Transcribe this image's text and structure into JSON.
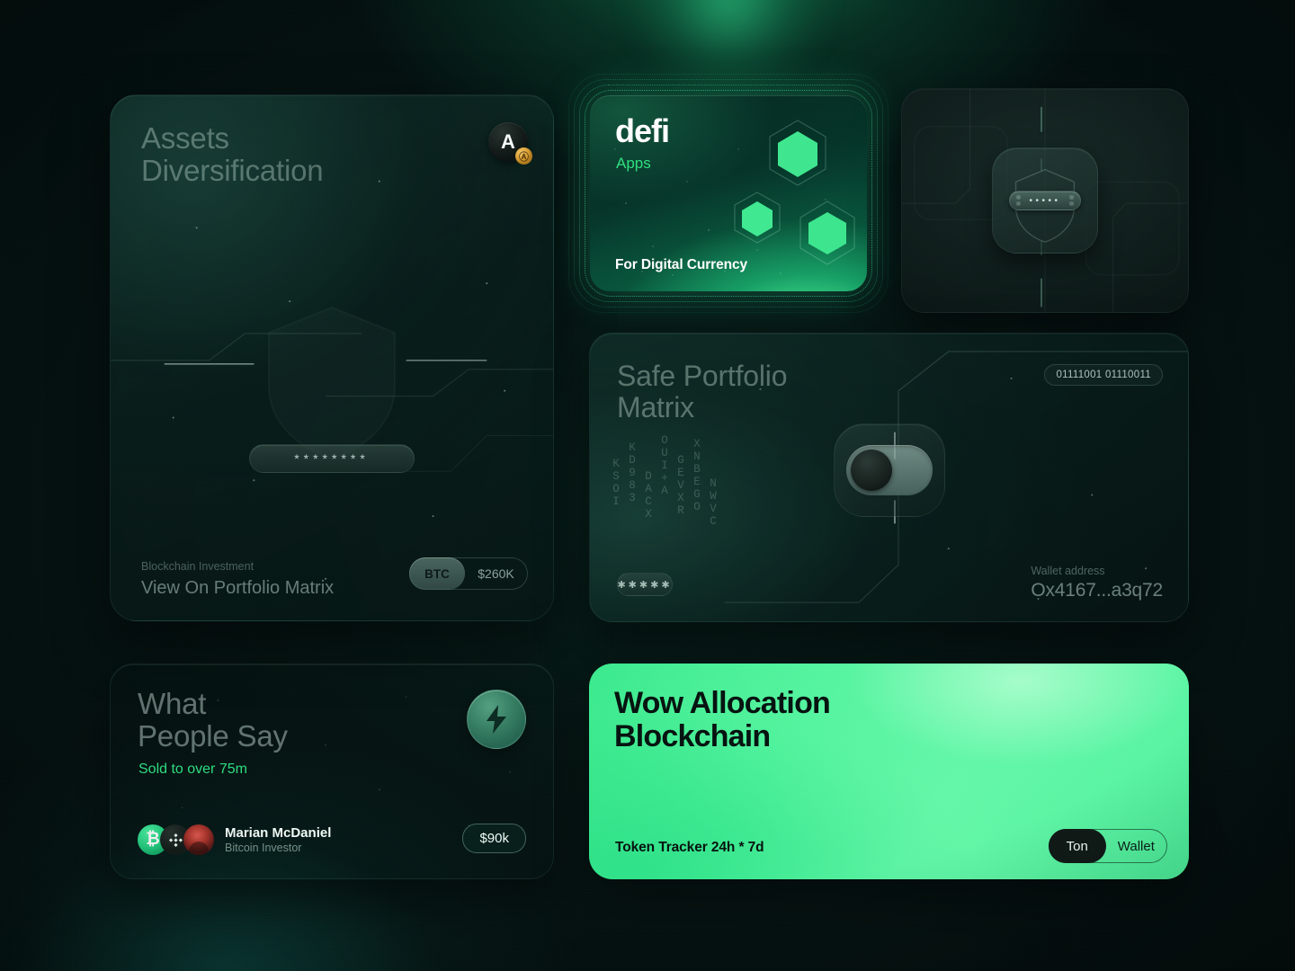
{
  "theme": {
    "accent_green": "#2fdc7f",
    "bright_green": "#4ff29b",
    "dark_bg": "#040d0d",
    "muted_text": "#c4dcd2"
  },
  "assets_card": {
    "title_line1": "Assets",
    "title_line2": "Diversification",
    "badge_glyph": "A",
    "badge_sub_glyph": "Ⓐ",
    "password_mask": "********",
    "kicker": "Blockchain Investment",
    "foot_title": "View On Portfolio Matrix",
    "pill_active": "BTC",
    "pill_value": "$260K"
  },
  "defi_card": {
    "logo": "defi",
    "subtitle": "Apps",
    "tagline": "For Digital Currency"
  },
  "secure_card": {
    "chip_dots": "•••••"
  },
  "matrix_card": {
    "title_line1": "Safe Portfolio",
    "title_line2": "Matrix",
    "binary_pill": "01111001 01110011",
    "dots_pill": "✱✱✱✱✱",
    "wallet_label": "Wallet address",
    "wallet_value": "Ox4167...a3q72",
    "rain_columns": [
      "KSOI",
      "KD983",
      "DACX",
      "OUI+A",
      "GEVXR",
      "XNBEGO",
      "NWVC"
    ]
  },
  "people_card": {
    "title_line1": "What",
    "title_line2": "People Say",
    "sold_text": "Sold to over 75m",
    "person_name": "Marian McDaniel",
    "person_role": "Bitcoin Investor",
    "amount_pill": "$90k",
    "btc_glyph": "₿"
  },
  "wow_card": {
    "title_line1": "Wow Allocation",
    "title_line2": "Blockchain",
    "tracker": "Token Tracker 24h * 7d",
    "seg_active": "Ton",
    "seg_inactive": "Wallet"
  }
}
